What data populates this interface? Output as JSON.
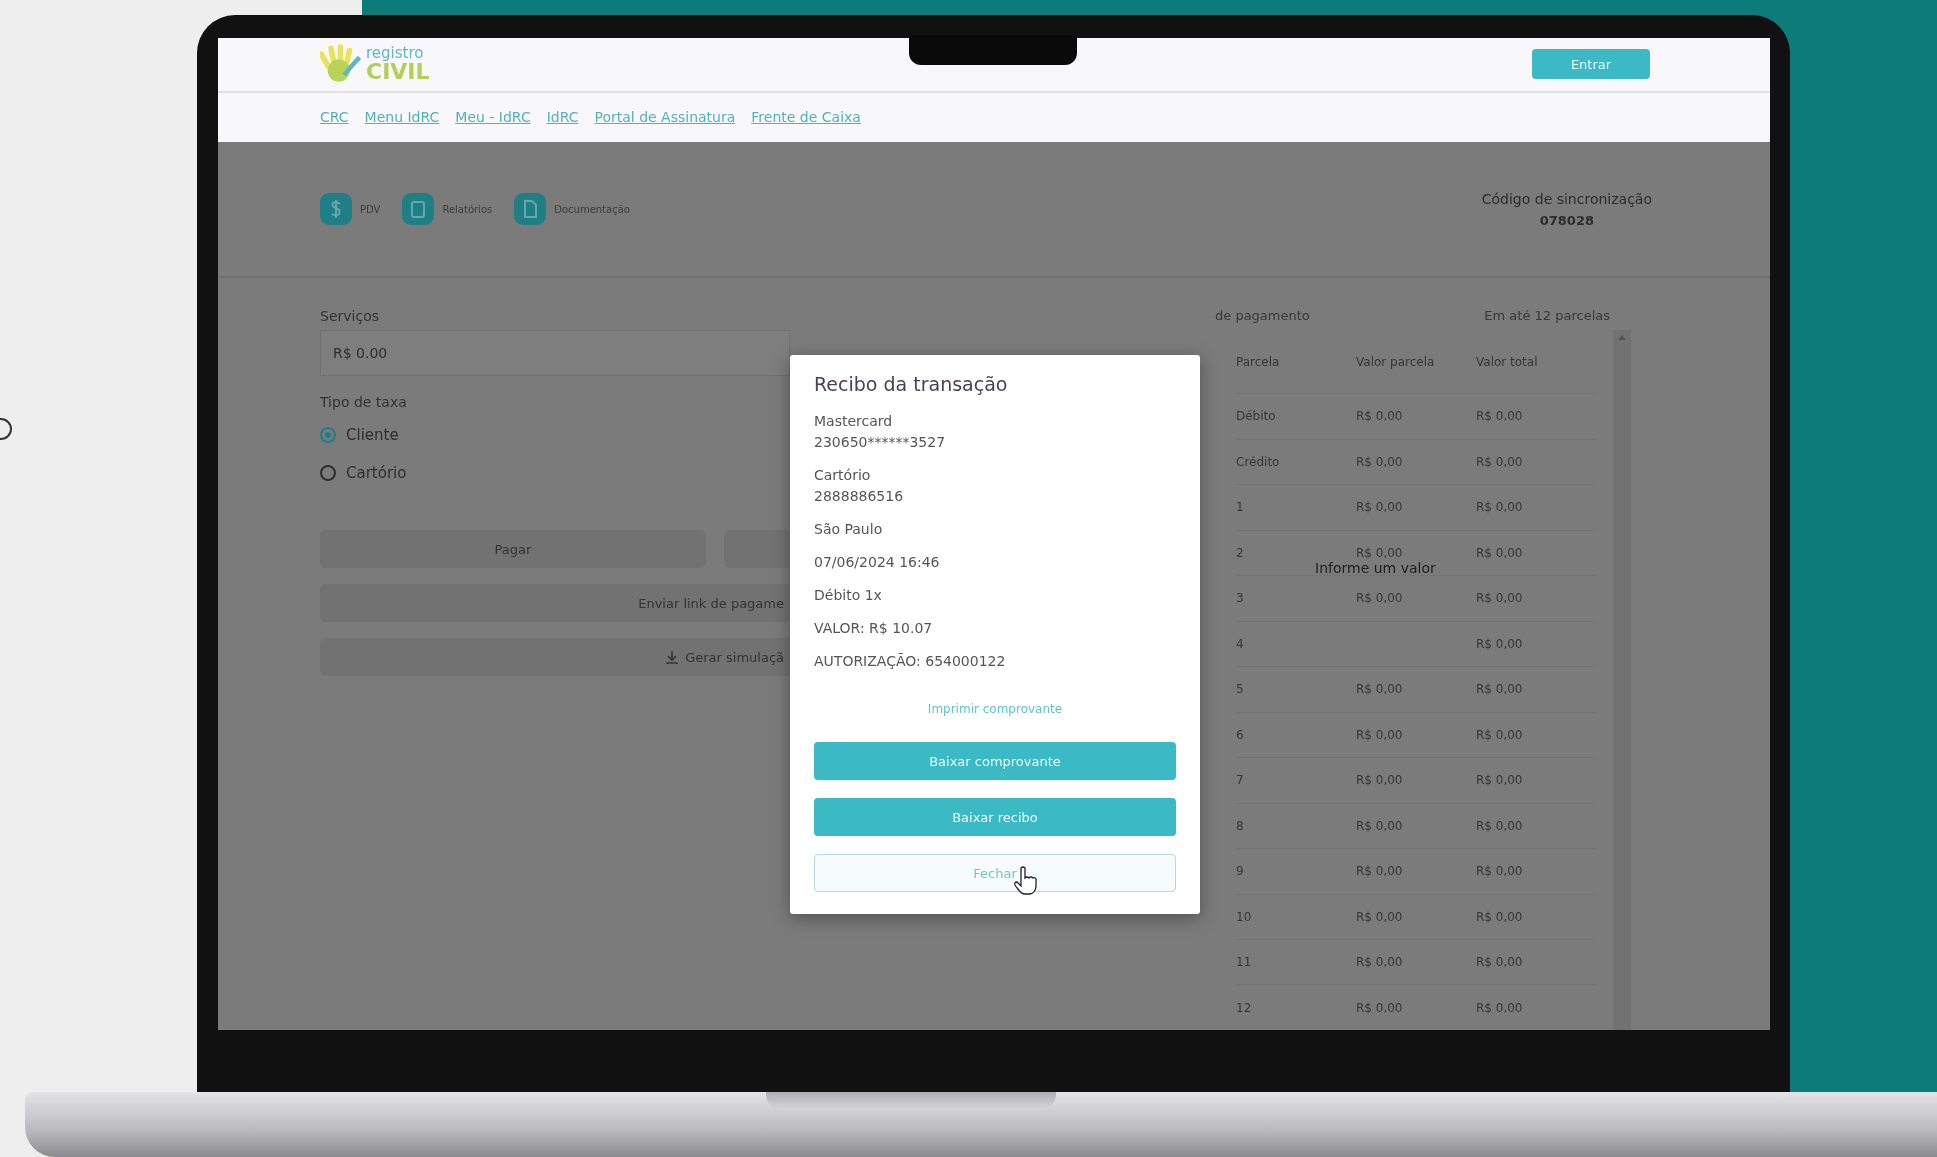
{
  "header": {
    "logo": {
      "line1": "registro",
      "line2": "CIVIL"
    },
    "login_button": "Entrar"
  },
  "nav_links": [
    "CRC",
    "Menu IdRC",
    "Meu - IdRC",
    "IdRC",
    "Portal de Assinatura",
    "Frente de Caixa"
  ],
  "toolbar": {
    "items": [
      {
        "label": "PDV"
      },
      {
        "label": "Relatórios"
      },
      {
        "label": "Documentação"
      }
    ],
    "sync_label": "Código de sincronização",
    "sync_code": "078028"
  },
  "form": {
    "services_label": "Serviços",
    "services_value": "R$ 0.00",
    "fee_type_label": "Tipo de taxa",
    "fee_options": [
      {
        "label": "Cliente",
        "selected": true
      },
      {
        "label": "Cartório",
        "selected": false
      }
    ],
    "pay_button": "Pagar",
    "send_link_button": "Enviar link de pagame",
    "simulate_button": "Gerar simulaçã"
  },
  "payment_panel": {
    "title": "de pagamento",
    "installments_label": "Em até 12 parcelas",
    "columns": [
      "Parcela",
      "Valor parcela",
      "Valor total"
    ],
    "rows": [
      {
        "parcela": "Débito",
        "valor_parcela": "R$ 0,00",
        "valor_total": "R$ 0,00"
      },
      {
        "parcela": "Crédito",
        "valor_parcela": "R$ 0,00",
        "valor_total": "R$ 0,00"
      },
      {
        "parcela": "1",
        "valor_parcela": "R$ 0,00",
        "valor_total": "R$ 0,00"
      },
      {
        "parcela": "2",
        "valor_parcela": "R$ 0,00",
        "valor_total": "R$ 0,00"
      },
      {
        "parcela": "3",
        "valor_parcela": "R$ 0,00",
        "valor_total": "R$ 0,00"
      },
      {
        "parcela": "4",
        "valor_total": "R$ 0,00"
      },
      {
        "parcela": "5",
        "valor_parcela": "R$ 0,00",
        "valor_total": "R$ 0,00"
      },
      {
        "parcela": "6",
        "valor_parcela": "R$ 0,00",
        "valor_total": "R$ 0,00"
      },
      {
        "parcela": "7",
        "valor_parcela": "R$ 0,00",
        "valor_total": "R$ 0,00"
      },
      {
        "parcela": "8",
        "valor_parcela": "R$ 0,00",
        "valor_total": "R$ 0,00"
      },
      {
        "parcela": "9",
        "valor_parcela": "R$ 0,00",
        "valor_total": "R$ 0,00"
      },
      {
        "parcela": "10",
        "valor_parcela": "R$ 0,00",
        "valor_total": "R$ 0,00"
      },
      {
        "parcela": "11",
        "valor_parcela": "R$ 0,00",
        "valor_total": "R$ 0,00"
      },
      {
        "parcela": "12",
        "valor_parcela": "R$ 0,00",
        "valor_total": "R$ 0,00"
      }
    ],
    "empty_message": "Informe um valor"
  },
  "modal": {
    "title": "Recibo da transação",
    "groups": [
      [
        "Mastercard",
        "230650******3527"
      ],
      [
        "Cartório",
        "2888886516"
      ],
      [
        "São Paulo"
      ],
      [
        "07/06/2024 16:46"
      ],
      [
        "Débito 1x"
      ],
      [
        "VALOR: R$ 10.07"
      ],
      [
        "AUTORIZAÇÃO: 654000122"
      ]
    ],
    "print_link": "Imprimir comprovante",
    "buttons": [
      {
        "label": "Baixar comprovante",
        "kind": "primary"
      },
      {
        "label": "Baixar recibo",
        "kind": "primary"
      },
      {
        "label": "Fechar",
        "kind": "outline"
      }
    ]
  }
}
